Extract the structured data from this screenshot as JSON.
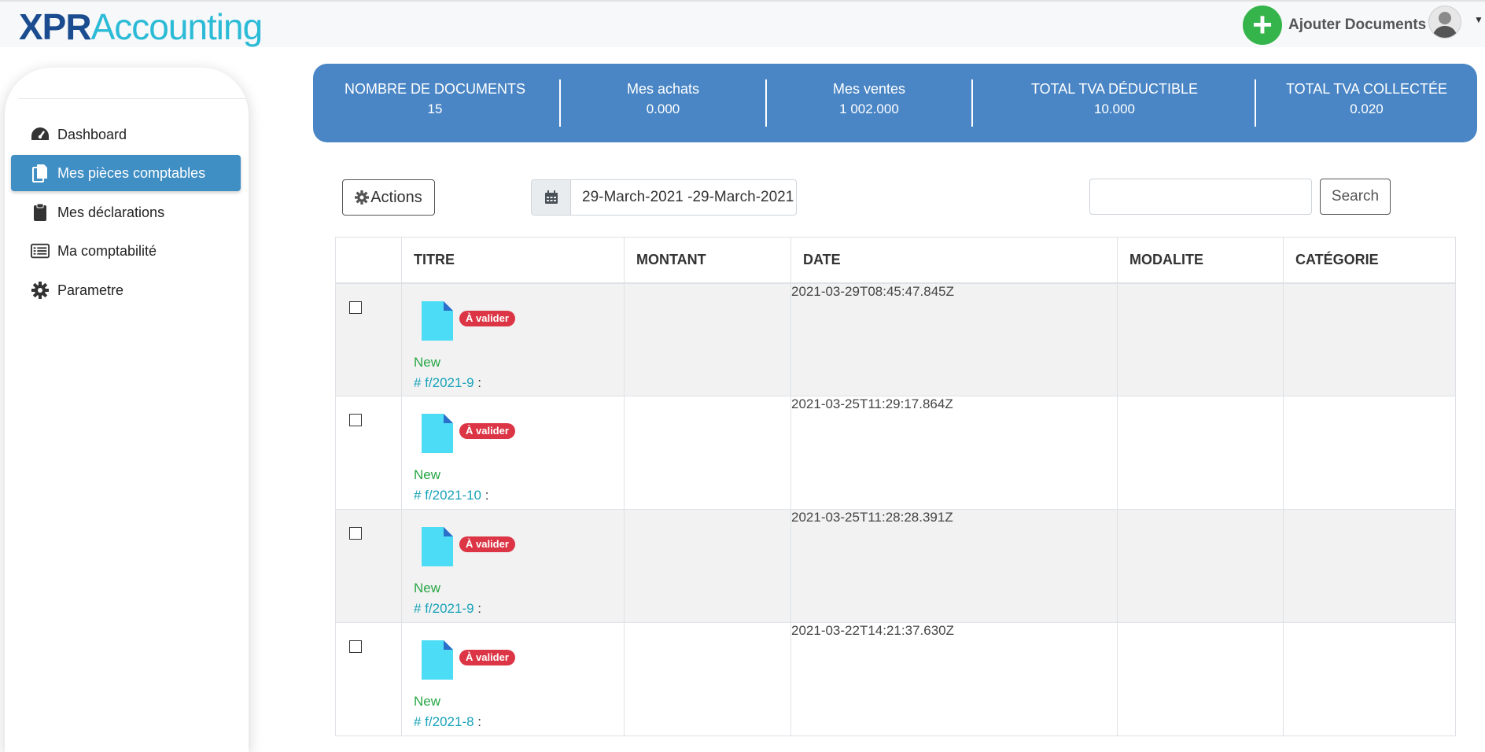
{
  "app": {
    "logo_bold": "XPR",
    "logo_light": "Accounting",
    "add_documents_label": "Ajouter Documents"
  },
  "sidebar": {
    "items": [
      {
        "label": "Dashboard",
        "icon": "tachometer-icon"
      },
      {
        "label": "Mes pièces comptables",
        "icon": "copy-icon",
        "active": true
      },
      {
        "label": "Mes déclarations",
        "icon": "clipboard-icon"
      },
      {
        "label": "Ma comptabilité",
        "icon": "list-alt-icon"
      },
      {
        "label": "Parametre",
        "icon": "gear-icon"
      }
    ]
  },
  "stats": [
    {
      "label": "NOMBRE DE DOCUMENTS",
      "value": "15"
    },
    {
      "label": "Mes achats",
      "value": "0.000"
    },
    {
      "label": "Mes ventes",
      "value": "1 002.000"
    },
    {
      "label": "TOTAL TVA DÉDUCTIBLE",
      "value": "10.000"
    },
    {
      "label": "TOTAL TVA COLLECTÉE",
      "value": "0.020"
    }
  ],
  "toolbar": {
    "actions_label": "Actions",
    "date_range_value": "29-March-2021 -29-March-2021",
    "search_value": "",
    "search_button_label": "Search"
  },
  "table": {
    "headers": [
      "",
      "TITRE",
      "MONTANT",
      "DATE",
      "MODALITE",
      "CATÉGORIE"
    ],
    "rows": [
      {
        "badge": "À valider",
        "status": "New",
        "ref": "# f/2021-9",
        "suffix": " :",
        "montant": "",
        "date": "2021-03-29T08:45:47.845Z",
        "modalite": "",
        "categorie": ""
      },
      {
        "badge": "À valider",
        "status": "New",
        "ref": "# f/2021-10",
        "suffix": " :",
        "montant": "",
        "date": "2021-03-25T11:29:17.864Z",
        "modalite": "",
        "categorie": ""
      },
      {
        "badge": "À valider",
        "status": "New",
        "ref": "# f/2021-9",
        "suffix": " :",
        "montant": "",
        "date": "2021-03-25T11:28:28.391Z",
        "modalite": "",
        "categorie": ""
      },
      {
        "badge": "À valider",
        "status": "New",
        "ref": "# f/2021-8",
        "suffix": " :",
        "montant": "",
        "date": "2021-03-22T14:21:37.630Z",
        "modalite": "",
        "categorie": ""
      }
    ]
  },
  "colors": {
    "stats_bg": "#4a86c5",
    "active_nav": "#3f8ec4",
    "badge": "#dc3545",
    "new_status": "#28a745",
    "ref_link": "#17a2b8",
    "add_button": "#34b44a"
  }
}
